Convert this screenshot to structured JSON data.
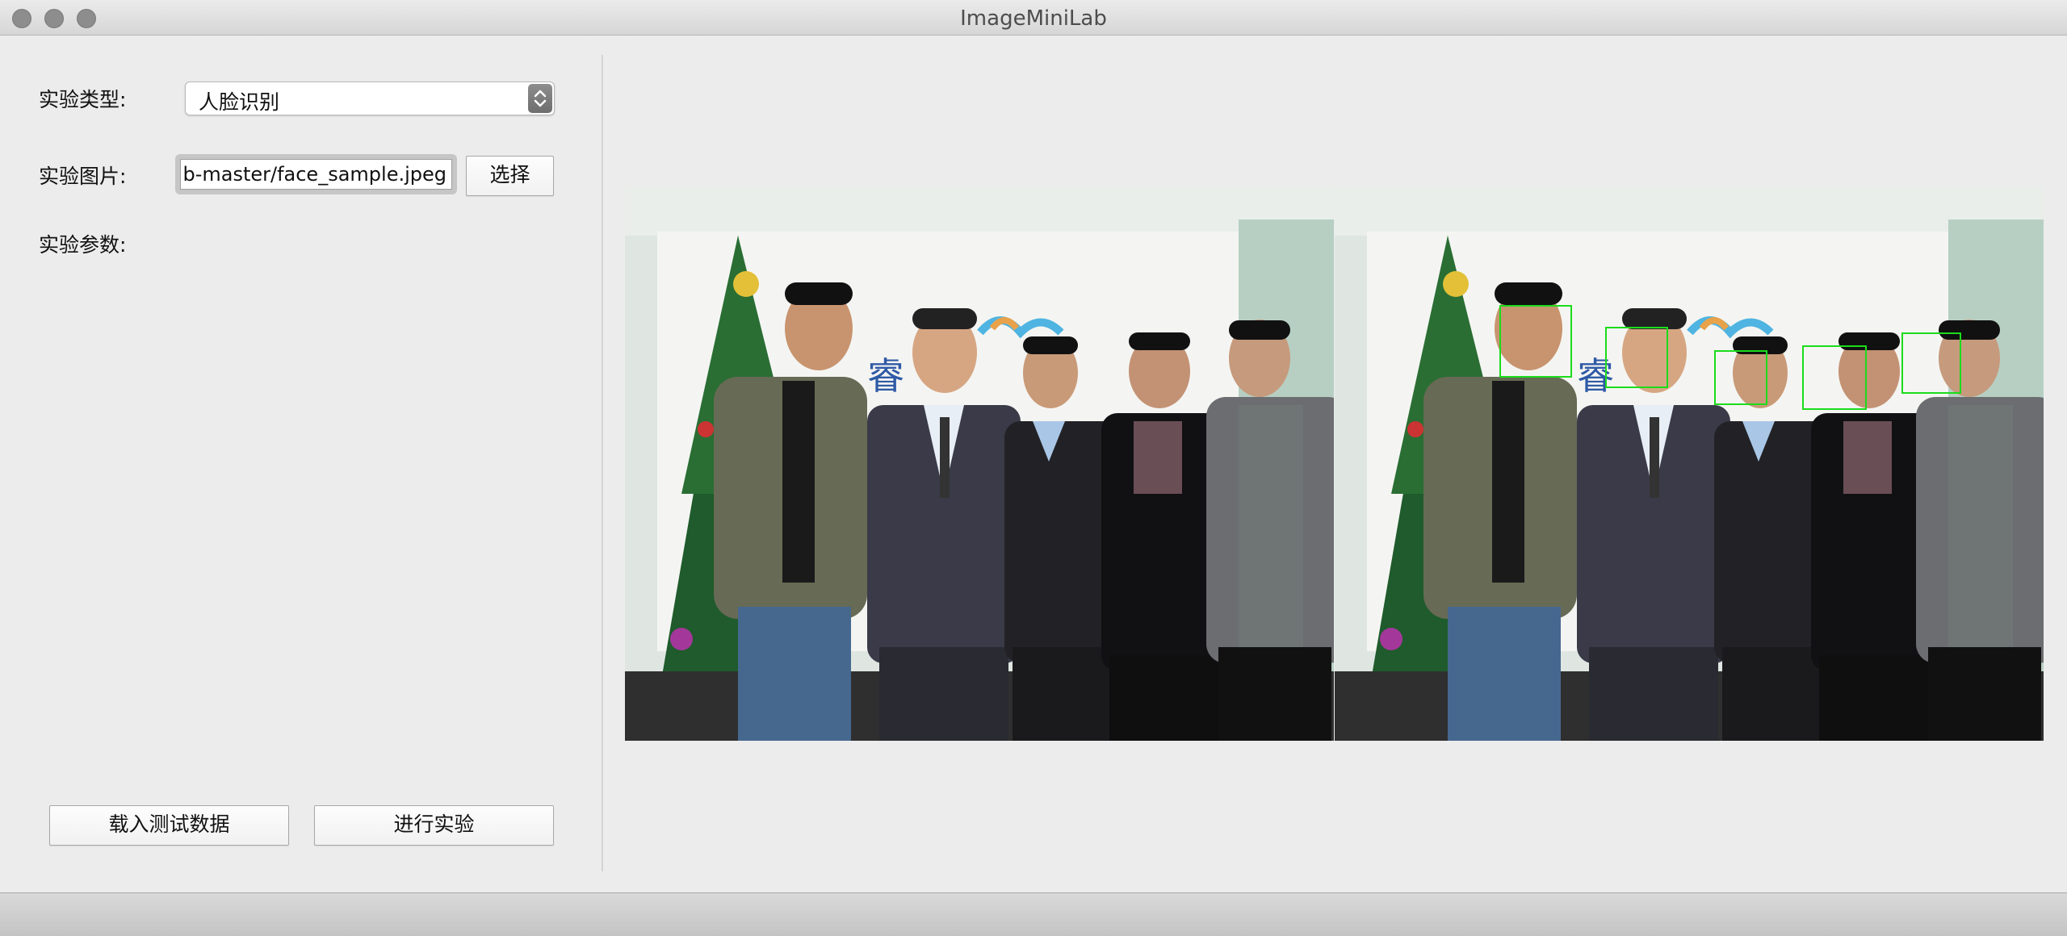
{
  "window": {
    "title": "ImageMiniLab"
  },
  "form": {
    "type_label": "实验类型:",
    "type_value": "人脸识别",
    "image_label": "实验图片:",
    "image_path": "b-master/face_sample.jpeg",
    "select_button": "选择",
    "params_label": "实验参数:"
  },
  "actions": {
    "load_test_data": "载入测试数据",
    "run_experiment": "进行实验"
  },
  "images": {
    "original_alt": "group photo",
    "result_alt": "group photo with detected faces",
    "detected_faces": 5
  },
  "colors": {
    "face_box": "#1bdc1b",
    "window_bg": "#ececec"
  }
}
